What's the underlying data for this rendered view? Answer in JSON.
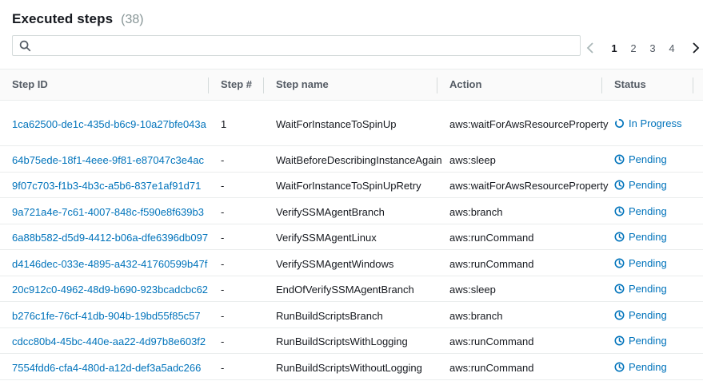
{
  "header": {
    "title": "Executed steps",
    "count": "(38)"
  },
  "search": {
    "placeholder": "",
    "value": ""
  },
  "pagination": {
    "pages": [
      "1",
      "2",
      "3",
      "4"
    ],
    "current": "1"
  },
  "columns": {
    "step_id": "Step ID",
    "step_num": "Step #",
    "step_name": "Step name",
    "action": "Action",
    "status": "Status"
  },
  "rows": [
    {
      "step_id": "1ca62500-de1c-435d-b6c9-10a27bfe043a",
      "step_num": "1",
      "step_name": "WaitForInstanceToSpinUp",
      "action": "aws:waitForAwsResourceProperty",
      "status": "In Progress",
      "status_icon": "spinner-icon"
    },
    {
      "step_id": "64b75ede-18f1-4eee-9f81-e87047c3e4ac",
      "step_num": "-",
      "step_name": "WaitBeforeDescribingInstanceAgain",
      "action": "aws:sleep",
      "status": "Pending",
      "status_icon": "clock-icon"
    },
    {
      "step_id": "9f07c703-f1b3-4b3c-a5b6-837e1af91d71",
      "step_num": "-",
      "step_name": "WaitForInstanceToSpinUpRetry",
      "action": "aws:waitForAwsResourceProperty",
      "status": "Pending",
      "status_icon": "clock-icon"
    },
    {
      "step_id": "9a721a4e-7c61-4007-848c-f590e8f639b3",
      "step_num": "-",
      "step_name": "VerifySSMAgentBranch",
      "action": "aws:branch",
      "status": "Pending",
      "status_icon": "clock-icon"
    },
    {
      "step_id": "6a88b582-d5d9-4412-b06a-dfe6396db097",
      "step_num": "-",
      "step_name": "VerifySSMAgentLinux",
      "action": "aws:runCommand",
      "status": "Pending",
      "status_icon": "clock-icon"
    },
    {
      "step_id": "d4146dec-033e-4895-a432-41760599b47f",
      "step_num": "-",
      "step_name": "VerifySSMAgentWindows",
      "action": "aws:runCommand",
      "status": "Pending",
      "status_icon": "clock-icon"
    },
    {
      "step_id": "20c912c0-4962-48d9-b690-923bcadcbc62",
      "step_num": "-",
      "step_name": "EndOfVerifySSMAgentBranch",
      "action": "aws:sleep",
      "status": "Pending",
      "status_icon": "clock-icon"
    },
    {
      "step_id": "b276c1fe-76cf-41db-904b-19bd55f85c57",
      "step_num": "-",
      "step_name": "RunBuildScriptsBranch",
      "action": "aws:branch",
      "status": "Pending",
      "status_icon": "clock-icon"
    },
    {
      "step_id": "cdcc80b4-45bc-440e-aa22-4d97b8e603f2",
      "step_num": "-",
      "step_name": "RunBuildScriptsWithLogging",
      "action": "aws:runCommand",
      "status": "Pending",
      "status_icon": "clock-icon"
    },
    {
      "step_id": "7554fdd6-cfa4-480d-a12d-def3a5adc266",
      "step_num": "-",
      "step_name": "RunBuildScriptsWithoutLogging",
      "action": "aws:runCommand",
      "status": "Pending",
      "status_icon": "clock-icon"
    }
  ],
  "colors": {
    "link": "#0073bb",
    "text": "#16191f",
    "muted": "#545b64",
    "border": "#eaeded"
  }
}
